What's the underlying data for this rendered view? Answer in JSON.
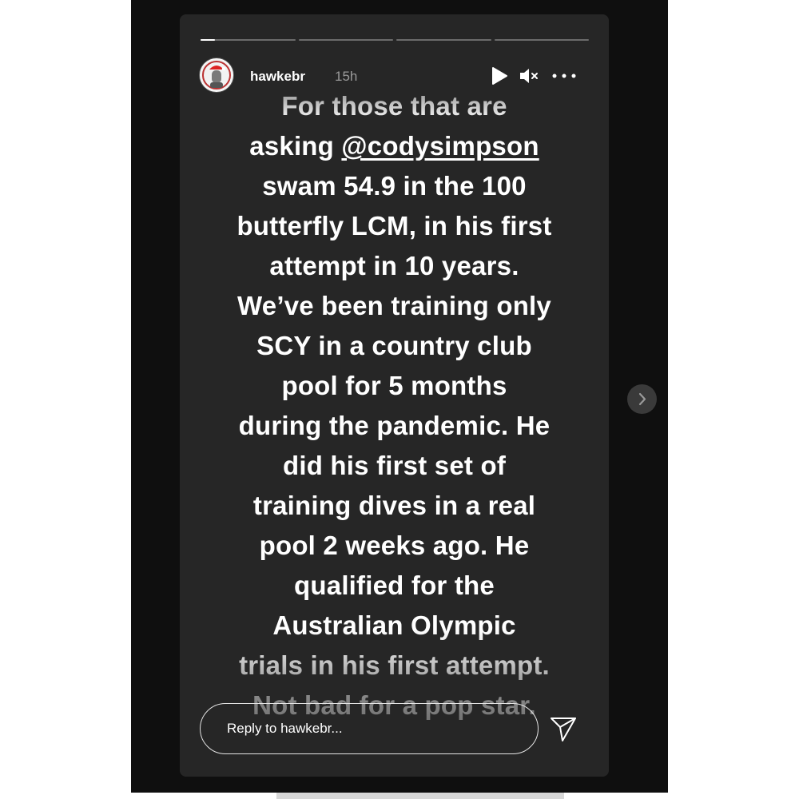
{
  "story": {
    "username": "hawkebr",
    "time_ago": "15h",
    "progress": {
      "segments": 4,
      "current_index": 0,
      "current_fill_fraction": 0.15
    },
    "text_before_mention": "For those that are",
    "text_asking": "asking ",
    "mention": "@codysimpson",
    "text_lines": [
      "swam 54.9 in the 100",
      "butterfly LCM, in his first",
      "attempt in 10 years.",
      "We’ve been training only",
      "SCY in a country club",
      "pool for 5 months",
      "during the pandemic. He",
      "did his first set of",
      "training dives in a real",
      "pool 2 weeks ago. He",
      "qualified for the",
      "Australian Olympic",
      "trials in his first attempt.",
      "Not bad for a pop star."
    ],
    "reply_placeholder": "Reply to hawkebr..."
  },
  "icons": {
    "play": "play-icon",
    "mute": "mute-icon",
    "more": "more-icon",
    "send": "send-icon",
    "next": "chevron-right-icon"
  },
  "colors": {
    "viewer_background": "#0f0f0f",
    "story_background": "#262626",
    "text": "#ffffff",
    "timestamp": "#9a9a9a"
  }
}
